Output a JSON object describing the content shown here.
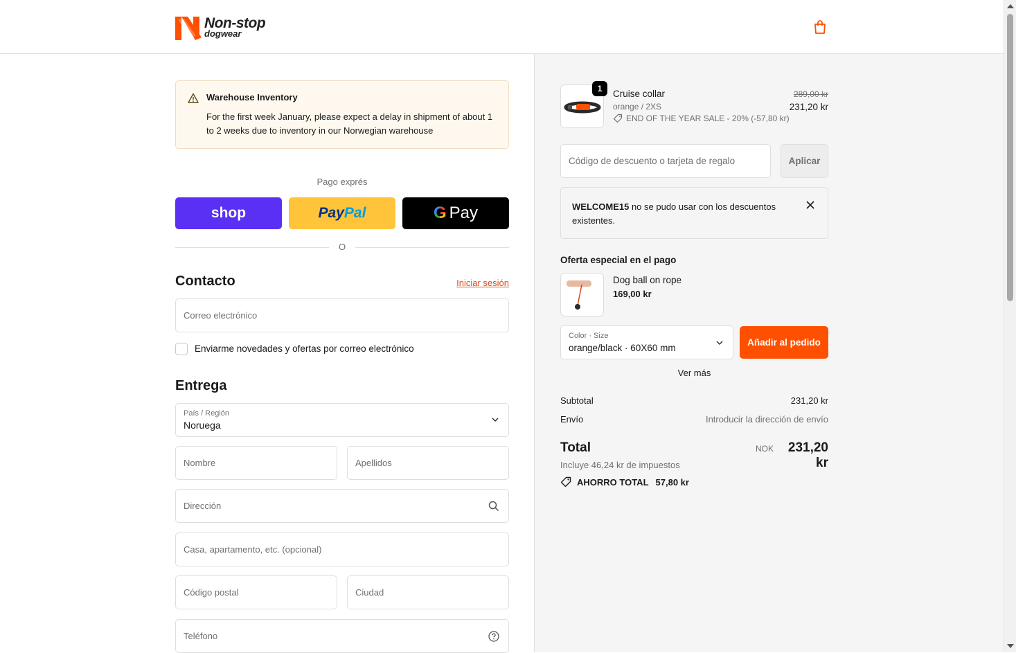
{
  "brand": {
    "line1": "Non-stop",
    "line2": "dogwear",
    "accent": "#ff4f00"
  },
  "notice": {
    "title": "Warehouse Inventory",
    "text": "For the first week January, please expect a delay in shipment of about 1 to 2 weeks due to inventory in our Norwegian warehouse"
  },
  "express": {
    "label": "Pago exprés",
    "shop": "shop",
    "paypal_a": "Pay",
    "paypal_b": "Pal",
    "gpay": "Pay",
    "or": "O"
  },
  "contact": {
    "title": "Contacto",
    "login": "Iniciar sesión",
    "email_placeholder": "Correo electrónico",
    "newsletter_label": "Enviarme novedades y ofertas por correo electrónico"
  },
  "delivery": {
    "title": "Entrega",
    "country_label": "País / Región",
    "country_value": "Noruega",
    "first_name": "Nombre",
    "last_name": "Apellidos",
    "address": "Dirección",
    "apartment": "Casa, apartamento, etc. (opcional)",
    "postal_code": "Código postal",
    "city": "Ciudad",
    "phone": "Teléfono"
  },
  "cart_item": {
    "quantity": "1",
    "name": "Cruise collar",
    "variant": "orange / 2XS",
    "discount": "END OF THE YEAR SALE - 20% (-57,80 kr)",
    "price_old": "289,00 kr",
    "price_new": "231,20 kr"
  },
  "discount_code": {
    "placeholder": "Código de descuento o tarjeta de regalo",
    "apply": "Aplicar"
  },
  "alert": {
    "code": "WELCOME15",
    "message": " no se pudo usar con los descuentos existentes."
  },
  "offer": {
    "title": "Oferta especial en el pago",
    "name": "Dog ball on rope",
    "price": "169,00 kr",
    "select_label": "Color · Size",
    "select_value": "orange/black · 60X60 mm",
    "add_button": "Añadir al pedido",
    "see_more": "Ver más"
  },
  "summary": {
    "subtotal_label": "Subtotal",
    "subtotal_value": "231,20 kr",
    "shipping_label": "Envío",
    "shipping_value": "Introducir la dirección de envío",
    "total_label": "Total",
    "currency": "NOK",
    "total_value": "231,20 kr",
    "tax_note": "Incluye 46,24 kr de impuestos",
    "savings_label": "AHORRO TOTAL",
    "savings_value": "57,80 kr"
  }
}
